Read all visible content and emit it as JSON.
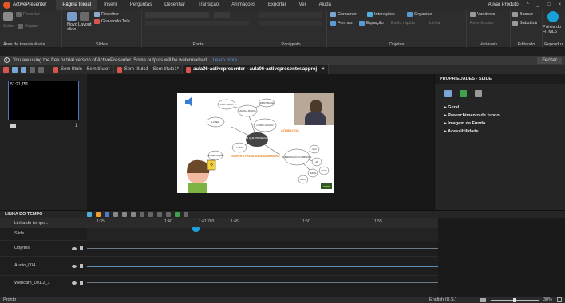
{
  "app": {
    "name": "ActivePresenter"
  },
  "menu": {
    "tabs": [
      "Página Inicial",
      "Inserir",
      "Perguntas",
      "Desenhar",
      "Transição",
      "Animações",
      "Exportar",
      "Ver",
      "Ajuda"
    ],
    "active_index": 0
  },
  "titlebar_right": {
    "product": "Ativar Produto",
    "caret": "^",
    "min": "_",
    "max": "□",
    "close": "×"
  },
  "ribbon": {
    "clipboard": {
      "cut": "Recortar",
      "copy": "Copiar",
      "paste": "Colar",
      "label": "Área de transferência"
    },
    "slides": {
      "new_slide": "Novo slide",
      "layout": "Layout",
      "redefine": "Redefinir",
      "record_screen": "Gravando Tela",
      "label": "Slides"
    },
    "font": {
      "label": "Fonte"
    },
    "paragraph": {
      "label": "Parágrafo"
    },
    "objects": {
      "container": "Container",
      "interactions": "Interações",
      "organize": "Organize",
      "forms": "Formas",
      "equation": "Equação",
      "quick_style": "Estilo rápido",
      "line": "Linha",
      "label": "Objetos"
    },
    "variables": {
      "variables": "Variáveis",
      "references": "Referências",
      "label": "Variáveis"
    },
    "editing": {
      "search": "Buscar",
      "replace": "Substituir",
      "label": "Editando"
    },
    "play": {
      "preview": "Prévia do HTML5",
      "label": "Reproduz"
    }
  },
  "notice": {
    "text": "You are using the free or trial version of ActivePresenter. Some outputs will be watermarked.",
    "link": "Learn more",
    "close": "Fechar"
  },
  "doc_tabs": [
    {
      "label": "Sem título - Sem título*",
      "active": false
    },
    {
      "label": "Sem título1 - Sem título1*",
      "active": false
    },
    {
      "label": "aula06-activepresenter - aula06-activepresenter.approj",
      "active": true
    }
  ],
  "slides_panel": {
    "thumb_time": "51:21,751",
    "slide_number": "1"
  },
  "slide": {
    "nodes": [
      "PROTEÇÃO",
      "FAMÍLIA RURAL",
      "IDENTIDADE",
      "LAZER",
      "COMO GRUPO",
      "LUTO",
      "ALIMENTAÇÃO",
      "SAÚDE"
    ],
    "center": "POR QUE PRESERVAR?",
    "highlight": "ATRIBUTOS",
    "orange_text": "ROMPER A FRAGILIDADE DA MEMÓRIA",
    "right_center": "ALIMENTAÇÃO DO AMBIENTE",
    "small_nodes": [
      "SAÚ",
      "AR",
      "TERRA",
      "ÁGUA",
      "CLIMA"
    ],
    "badge": "UFPR"
  },
  "properties": {
    "title": "PROPRIEDADES - SLIDE",
    "sections": [
      "Geral",
      "Preenchimento de fundo",
      "Imagem de Fundo",
      "Acessibilidade"
    ]
  },
  "timeline": {
    "title": "LINHA DO TEMPO",
    "top_row": "Linha do tempo...",
    "ruler": [
      "1:35",
      "1:40",
      "1:41,703",
      "1:45",
      "1:50",
      "1:55"
    ],
    "tracks": [
      "Slide",
      "Objetos",
      "Audio_004",
      "Webcam_001.2_1"
    ]
  },
  "status": {
    "left": "Pronto",
    "language": "English (U.S.)",
    "zoom": "30%"
  },
  "colors": {
    "accent": "#1aa0d8",
    "brand": "#e8552b",
    "link": "#5b8fd8"
  }
}
